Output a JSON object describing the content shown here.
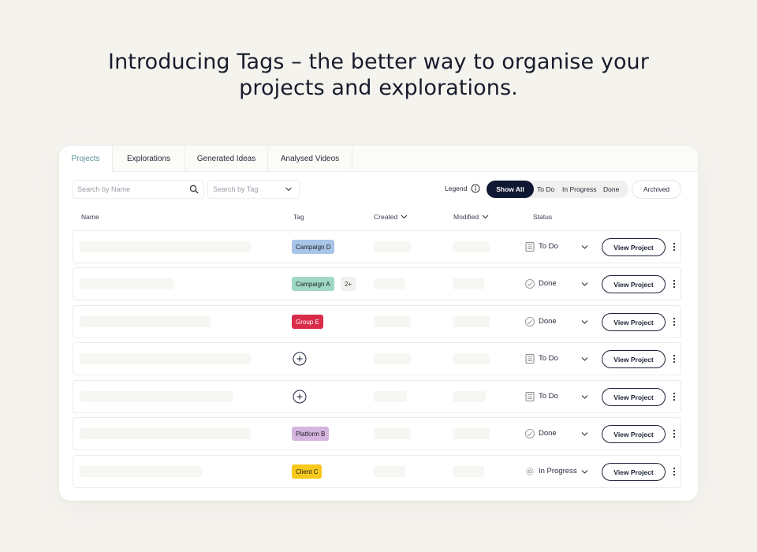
{
  "headline": {
    "line1": "Introducing Tags – the better way to organise your",
    "line2": "projects and explorations."
  },
  "tabs": [
    {
      "label": "Projects",
      "active": true
    },
    {
      "label": "Explorations",
      "active": false
    },
    {
      "label": "Generated Ideas",
      "active": false
    },
    {
      "label": "Analysed Videos",
      "active": false
    }
  ],
  "toolbar": {
    "search_placeholder": "Search by Name",
    "search_icon": "search-icon",
    "tag_placeholder": "Search by Tag",
    "legend_label": "Legend",
    "legend_icon": "info-icon",
    "filters": [
      {
        "label": "Show All",
        "active": true
      },
      {
        "label": "To Do",
        "active": false
      },
      {
        "label": "In Progress",
        "active": false
      },
      {
        "label": "Done",
        "active": false
      }
    ],
    "archived_label": "Archived"
  },
  "columns": {
    "name": "Name",
    "tag": "Tag",
    "created": "Created",
    "modified": "Modified",
    "status": "Status"
  },
  "rows": [
    {
      "tag": "Campaign D",
      "tag_color": "#a8c4e8",
      "extra_tags": "",
      "status": "To Do",
      "status_icon": "document-icon",
      "action": "View Project"
    },
    {
      "tag": "Campaign A",
      "tag_color": "#9fd9c4",
      "extra_tags": "2+",
      "status": "Done",
      "status_icon": "check-circle-icon",
      "action": "View Project"
    },
    {
      "tag": "Group E",
      "tag_color": "#d92b4a",
      "extra_tags": "",
      "status": "Done",
      "status_icon": "check-circle-icon",
      "action": "View Project"
    },
    {
      "tag": "",
      "tag_color": "",
      "extra_tags": "",
      "status": "To Do",
      "status_icon": "document-icon",
      "action": "View Project"
    },
    {
      "tag": "",
      "tag_color": "",
      "extra_tags": "",
      "status": "To Do",
      "status_icon": "document-icon",
      "action": "View Project"
    },
    {
      "tag": "Platform B",
      "tag_color": "#d6b4e0",
      "extra_tags": "",
      "status": "Done",
      "status_icon": "check-circle-icon",
      "action": "View Project"
    },
    {
      "tag": "Client C",
      "tag_color": "#f8c91c",
      "extra_tags": "",
      "status": "In Progress",
      "status_icon": "gear-icon",
      "action": "View Project"
    }
  ],
  "colors": {
    "background": "#f5f3ee",
    "primary_dark": "#0f1833",
    "active_tab": "#5c8f9a"
  }
}
